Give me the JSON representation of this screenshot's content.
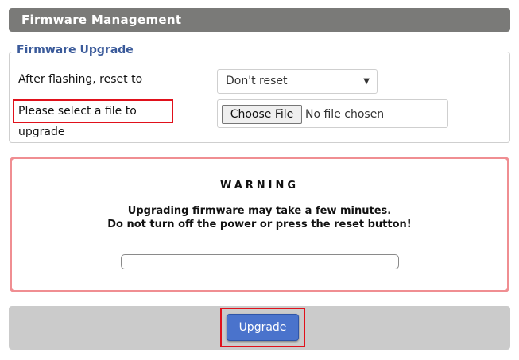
{
  "header": {
    "title": "Firmware Management"
  },
  "upgrade_section": {
    "legend": "Firmware Upgrade",
    "reset_label": "After flashing, reset to",
    "reset_select": {
      "selected": "Don't reset",
      "arrow_icon": "dropdown-arrow-icon"
    },
    "file_label": "Please select a file to upgrade",
    "file_input": {
      "button_label": "Choose File",
      "status": "No file chosen"
    }
  },
  "warning": {
    "title": "WARNING",
    "line1": "Upgrading firmware may take a few minutes.",
    "line2": "Do not turn off the power or press the reset button!",
    "progress_percent": 0,
    "border_color": "#f08e92"
  },
  "footer": {
    "upgrade_label": "Upgrade"
  },
  "colors": {
    "header_bg": "#7a7a78",
    "legend_text": "#3a5a9a",
    "highlight_red": "#e0111b",
    "button_blue": "#4a73cc",
    "footer_bg": "#cbcbcb"
  }
}
